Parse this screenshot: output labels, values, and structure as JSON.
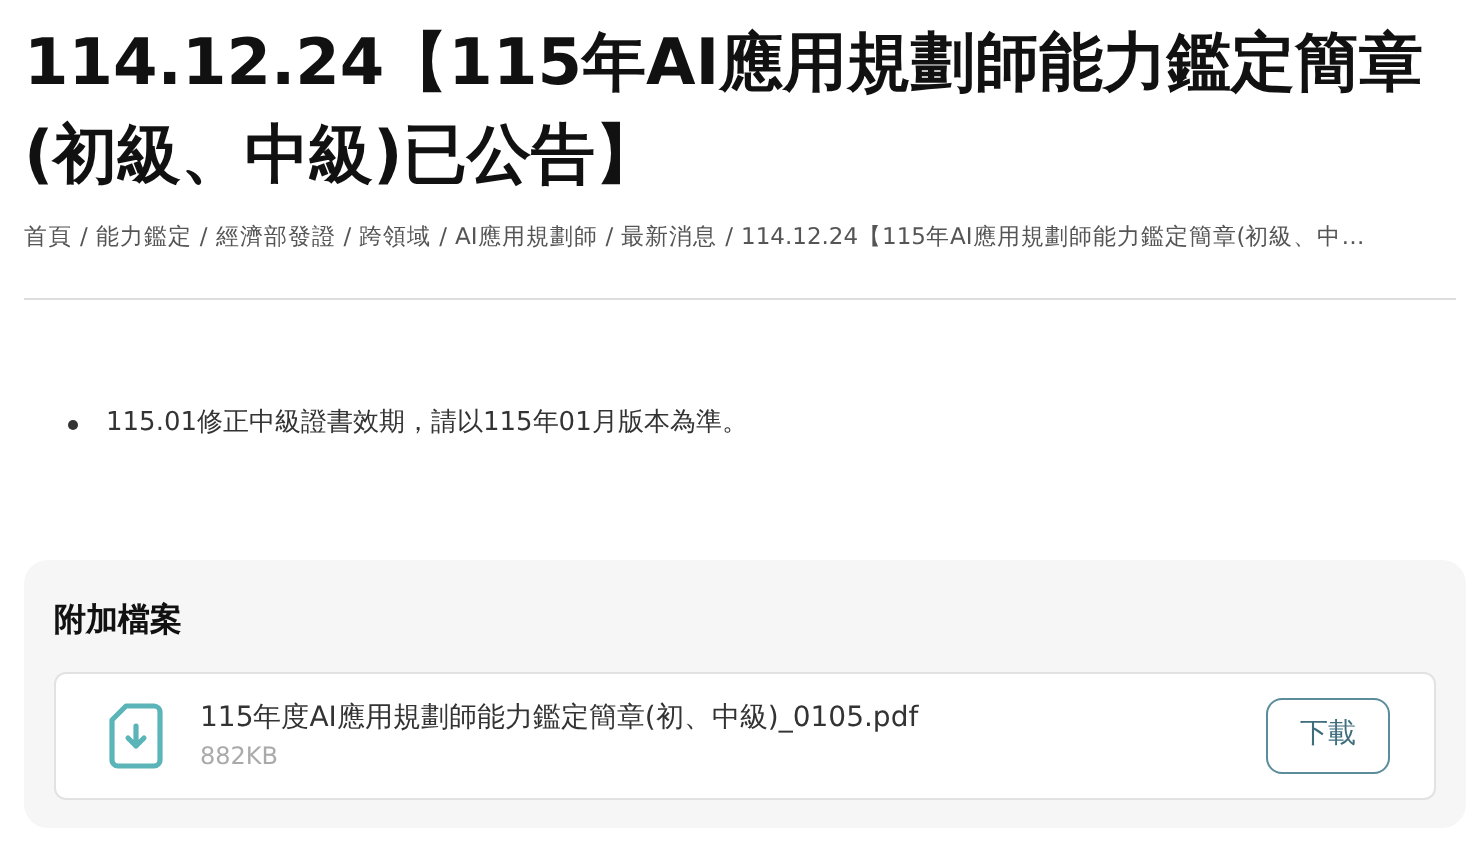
{
  "title": "114.12.24【115年AI應用規劃師能力鑑定簡章(初級、中級)已公告】",
  "breadcrumb": {
    "separator": "/",
    "items": [
      "首頁",
      "能力鑑定",
      "經濟部發證",
      "跨領域",
      "AI應用規劃師",
      "最新消息",
      "114.12.24【115年AI應用規劃師能力鑑定簡章(初級、中…"
    ]
  },
  "content": {
    "bullets": [
      "115.01修正中級證書效期，請以115年01月版本為準。"
    ]
  },
  "attachments": {
    "heading": "附加檔案",
    "files": [
      {
        "name": "115年度AI應用規劃師能力鑑定簡章(初、中級)_0105.pdf",
        "size": "882KB",
        "button": "下載"
      }
    ]
  }
}
